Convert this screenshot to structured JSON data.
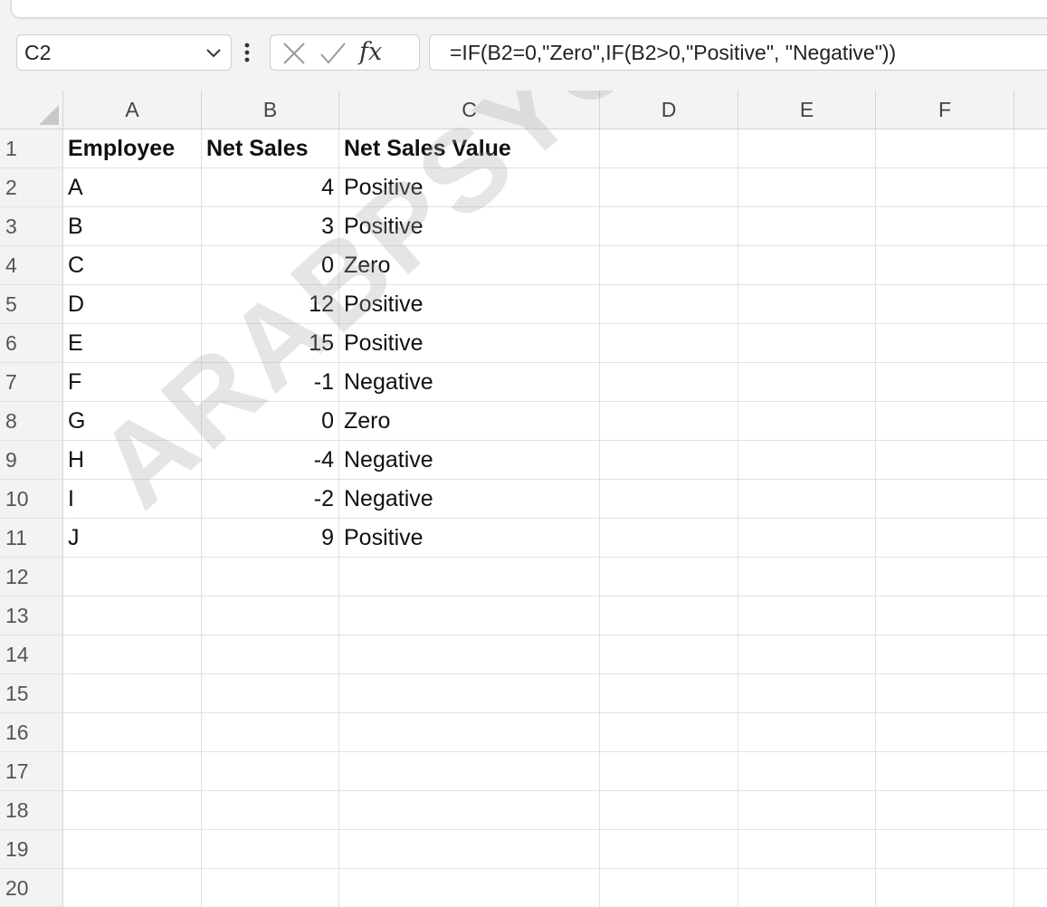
{
  "name_box": {
    "value": "C2"
  },
  "formula_bar": {
    "fx_label": "fx",
    "formula": "=IF(B2=0,\"Zero\",IF(B2>0,\"Positive\", \"Negative\"))"
  },
  "columns": [
    "A",
    "B",
    "C",
    "D",
    "E",
    "F"
  ],
  "rows": [
    "1",
    "2",
    "3",
    "4",
    "5",
    "6",
    "7",
    "8",
    "9",
    "10",
    "11",
    "12",
    "13",
    "14",
    "15",
    "16",
    "17",
    "18",
    "19",
    "20"
  ],
  "table": {
    "headers": [
      "Employee",
      "Net Sales",
      "Net Sales Value"
    ],
    "data": [
      [
        "A",
        "4",
        "Positive"
      ],
      [
        "B",
        "3",
        "Positive"
      ],
      [
        "C",
        "0",
        "Zero"
      ],
      [
        "D",
        "12",
        "Positive"
      ],
      [
        "E",
        "15",
        "Positive"
      ],
      [
        "F",
        "-1",
        "Negative"
      ],
      [
        "G",
        "0",
        "Zero"
      ],
      [
        "H",
        "-4",
        "Negative"
      ],
      [
        "I",
        "-2",
        "Negative"
      ],
      [
        "J",
        "9",
        "Positive"
      ]
    ]
  },
  "watermark": "ARABPSYCHOLOGY.COM",
  "colors": {
    "header_bg": "#f3f3f3",
    "grid_line": "#e1e1e1",
    "watermark": "#a0a0a0"
  }
}
